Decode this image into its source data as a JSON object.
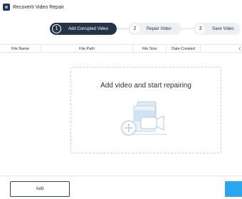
{
  "window": {
    "title": "Recoverit Video Repair",
    "app_icon": "recoverit-app-icon"
  },
  "stepper": {
    "steps": [
      {
        "number": "1",
        "label": "Add Corrupted Video",
        "active": true
      },
      {
        "number": "2",
        "label": "Repair Video",
        "active": false
      },
      {
        "number": "3",
        "label": "Save Video",
        "active": false
      }
    ]
  },
  "table": {
    "columns": [
      "File Name",
      "File Path",
      "File Size",
      "Date Created",
      "("
    ]
  },
  "dropzone": {
    "title": "Add video and start repairing",
    "icon": "add-video-illustration-icon"
  },
  "footer": {
    "add_label": "Add",
    "repair_label": ""
  },
  "colors": {
    "accent": "#2aa6f0",
    "step_active": "#243447",
    "step_inactive": "#eef1f4"
  }
}
